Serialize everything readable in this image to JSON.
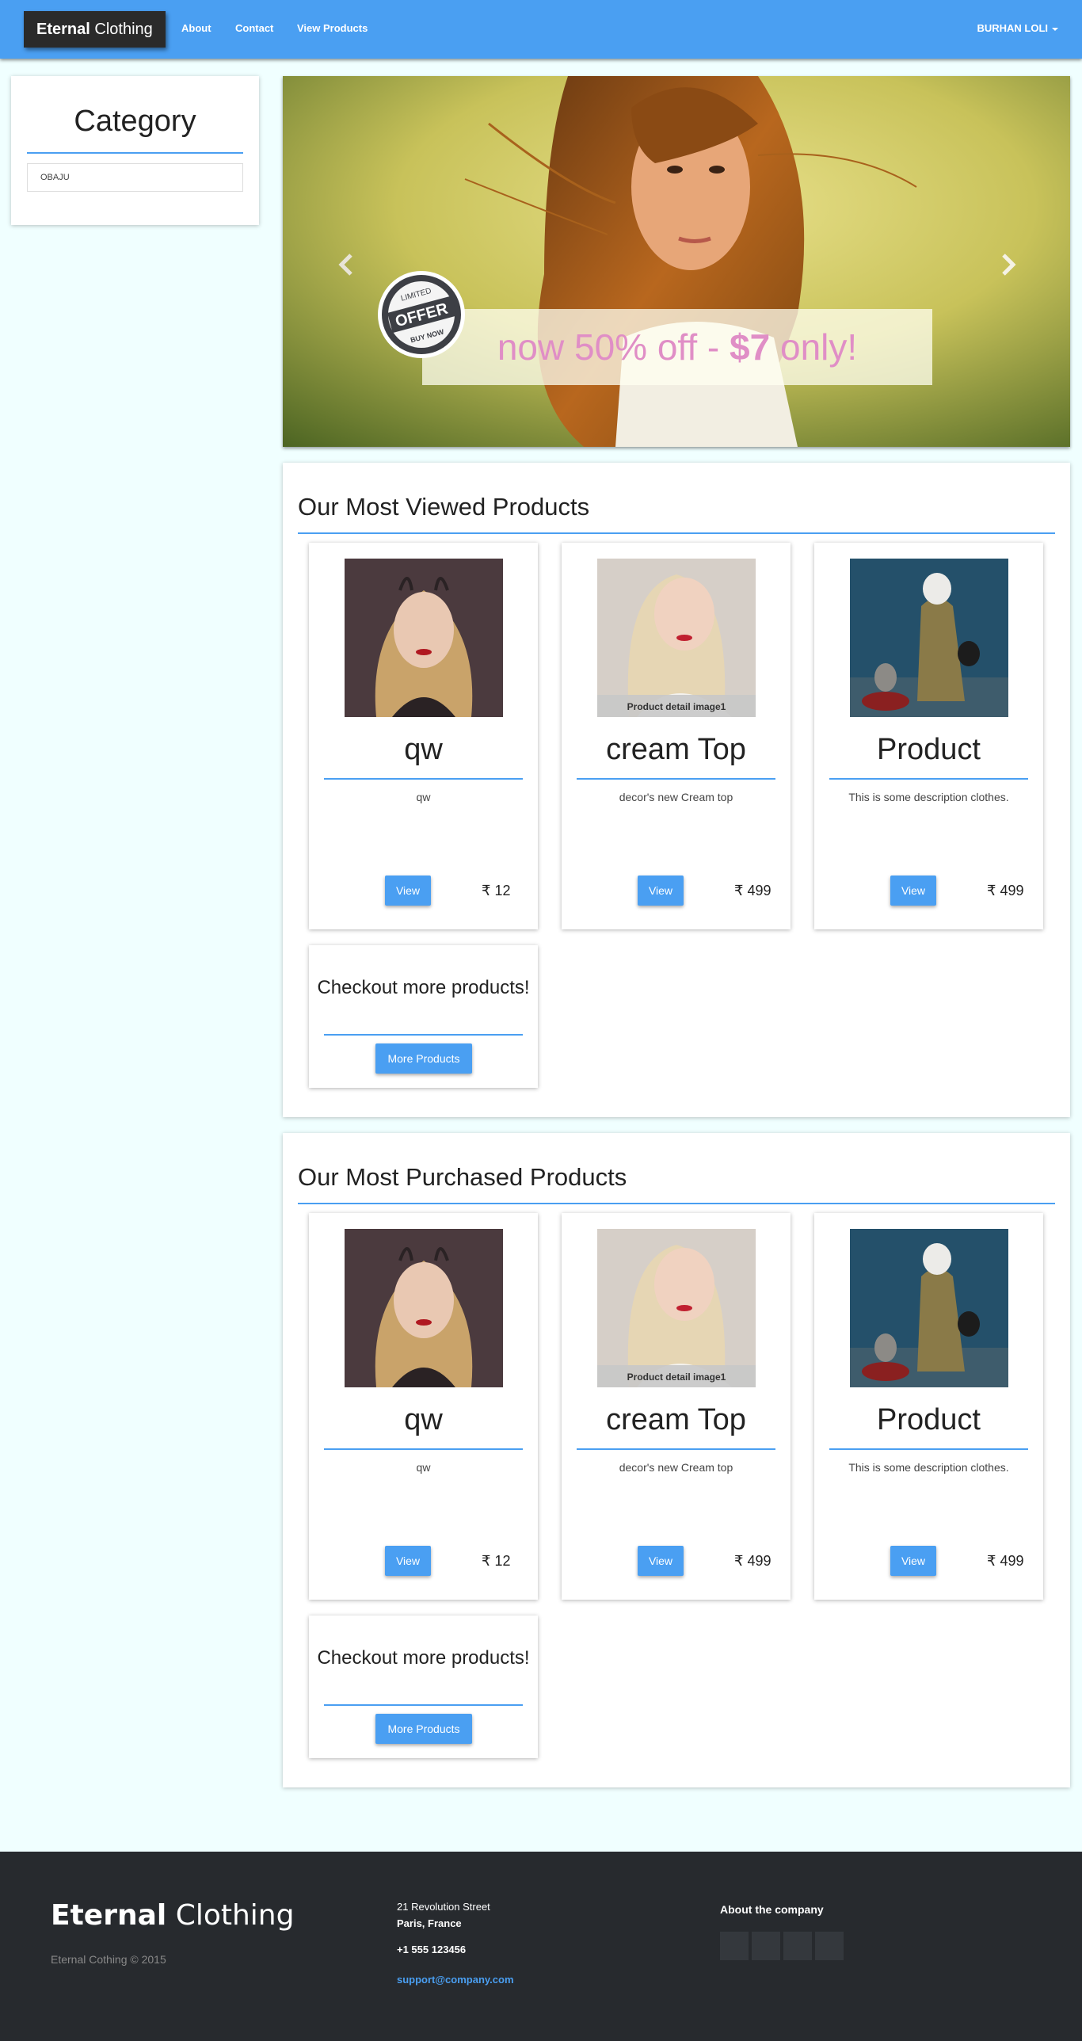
{
  "navbar": {
    "brand_bold": "Eternal",
    "brand_rest": "Clothing",
    "links": [
      "About",
      "Contact",
      "View Products"
    ],
    "user": "BURHAN LOLI"
  },
  "category": {
    "title": "Category",
    "items": [
      "OBAJU"
    ]
  },
  "carousel": {
    "offer_prefix": "now 50% off - ",
    "offer_price": "$7",
    "offer_suffix": " only!",
    "badge": {
      "line1": "LIMITED",
      "line2": "OFFER",
      "line3": "BUY NOW"
    },
    "image_caption": "Product detail image1"
  },
  "sections": [
    {
      "title": "Our Most Viewed Products",
      "products": [
        {
          "name": "qw",
          "description": "qw",
          "view_label": "View",
          "price": "₹ 12"
        },
        {
          "name": "cream Top",
          "description": "decor's new Cream top",
          "view_label": "View",
          "price": "₹ 499"
        },
        {
          "name": "Product",
          "description": "This is some description clothes.",
          "view_label": "View",
          "price": "₹ 499"
        }
      ],
      "more": {
        "title": "Checkout more products!",
        "button": "More Products"
      }
    },
    {
      "title": "Our Most Purchased Products",
      "products": [
        {
          "name": "qw",
          "description": "qw",
          "view_label": "View",
          "price": "₹ 12"
        },
        {
          "name": "cream Top",
          "description": "decor's new Cream top",
          "view_label": "View",
          "price": "₹ 499"
        },
        {
          "name": "Product",
          "description": "This is some description clothes.",
          "view_label": "View",
          "price": "₹ 499"
        }
      ],
      "more": {
        "title": "Checkout more products!",
        "button": "More Products"
      }
    }
  ],
  "footer": {
    "brand_bold": "Eternal",
    "brand_rest": "Clothing",
    "copyright": "Eternal Cothing © 2015",
    "address_line1": "21 Revolution Street",
    "address_line2": "Paris, France",
    "phone": "+1 555 123456",
    "email": "support@company.com",
    "about": "About the company"
  },
  "colors": {
    "accent": "#4a9ff2",
    "footer_bg": "#272a2e",
    "page_bg": "#f0ffff",
    "offer_text": "#e08ec6"
  }
}
